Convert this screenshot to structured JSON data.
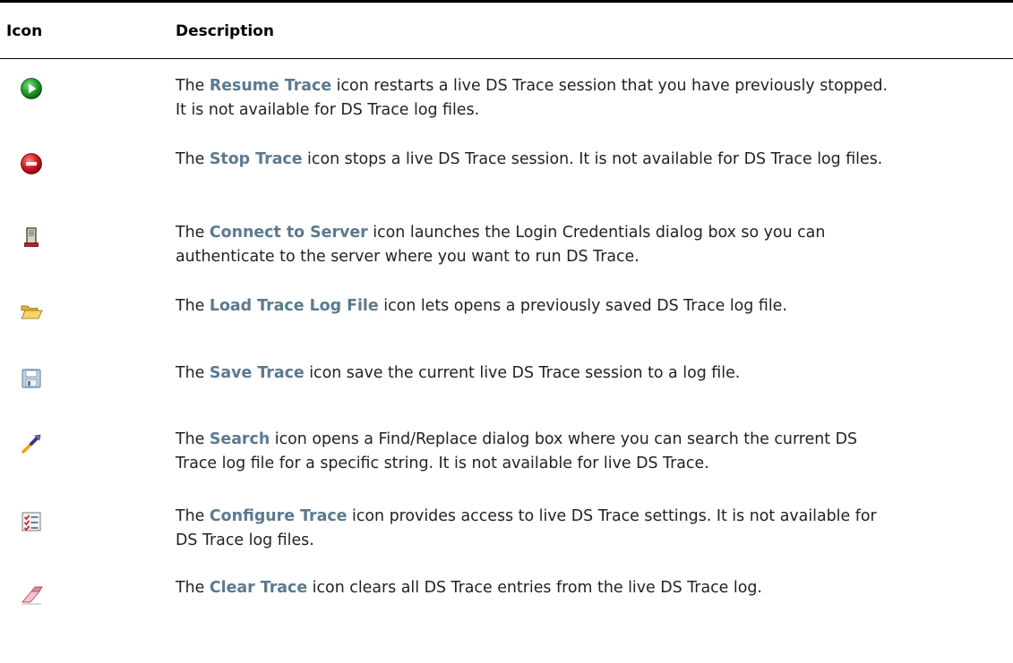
{
  "table": {
    "header": {
      "icon": "Icon",
      "description": "Description"
    },
    "rows": [
      {
        "icon": "resume-trace-icon",
        "pre": "The ",
        "term": "Resume Trace",
        "post": " icon restarts a live DS Trace session that you have previously stopped. It is not available for DS Trace log files."
      },
      {
        "icon": "stop-trace-icon",
        "pre": "The ",
        "term": "Stop Trace",
        "post": " icon stops a live DS Trace session. It is not available for DS Trace log files."
      },
      {
        "icon": "connect-to-server-icon",
        "pre": "The ",
        "term": "Connect to Server",
        "post": " icon launches the Login Credentials dialog box so you can authenticate to the server where you want to run DS Trace."
      },
      {
        "icon": "load-trace-log-file-icon",
        "pre": "The ",
        "term": "Load Trace Log File",
        "post": " icon lets opens a previously saved DS Trace log file."
      },
      {
        "icon": "save-trace-icon",
        "pre": "The ",
        "term": "Save Trace",
        "post": " icon save the current live DS Trace session to a log file."
      },
      {
        "icon": "search-icon",
        "pre": "The ",
        "term": "Search",
        "post": " icon opens a Find/Replace dialog box where you can search the current DS Trace log file for a specific string. It is not available for live DS Trace."
      },
      {
        "icon": "configure-trace-icon",
        "pre": "The ",
        "term": "Configure Trace",
        "post": " icon provides access to live DS Trace settings. It is not available for DS Trace log files."
      },
      {
        "icon": "clear-trace-icon",
        "pre": "The ",
        "term": "Clear Trace",
        "post": " icon clears all DS Trace entries from the live DS Trace log."
      }
    ]
  },
  "colors": {
    "term": "#5b7a8f",
    "text": "#222222",
    "rule": "#000000"
  }
}
